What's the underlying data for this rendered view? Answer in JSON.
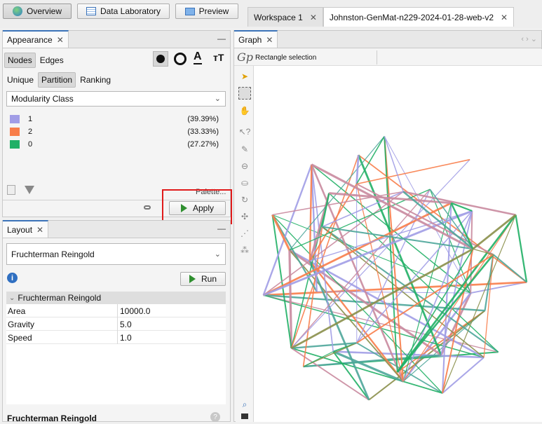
{
  "toolbar": {
    "overview_label": "Overview",
    "data_lab_label": "Data Laboratory",
    "preview_label": "Preview"
  },
  "workspace_tabs": [
    {
      "label": "Workspace 1"
    },
    {
      "label": "Johnston-GenMat-n229-2024-01-28-web-v2"
    }
  ],
  "appearance": {
    "tab_label": "Appearance",
    "element_tabs": [
      "Nodes",
      "Edges"
    ],
    "mode_tabs": [
      "Unique",
      "Partition",
      "Ranking"
    ],
    "attribute": "Modularity Class",
    "partitions": [
      {
        "name": "1",
        "pct": "(39.39%)",
        "color": "#a19de6"
      },
      {
        "name": "2",
        "pct": "(33.33%)",
        "color": "#f87d4a"
      },
      {
        "name": "0",
        "pct": "(27.27%)",
        "color": "#21b066"
      }
    ],
    "palette_label": "Palette...",
    "apply_label": "Apply"
  },
  "layout": {
    "tab_label": "Layout",
    "algorithm": "Fruchterman Reingold",
    "run_label": "Run",
    "section_title": "Fruchterman Reingold",
    "properties": [
      {
        "key": "Area",
        "value": "10000.0"
      },
      {
        "key": "Gravity",
        "value": "5.0"
      },
      {
        "key": "Speed",
        "value": "1.0"
      }
    ],
    "footer_title": "Fruchterman Reingold"
  },
  "graph": {
    "tab_label": "Graph",
    "tool_label": "Rectangle selection",
    "edge_colors": [
      "#a19de6",
      "#f87d4a",
      "#21b066",
      "#8a8f4a",
      "#c98a9e",
      "#4ea69a"
    ]
  }
}
